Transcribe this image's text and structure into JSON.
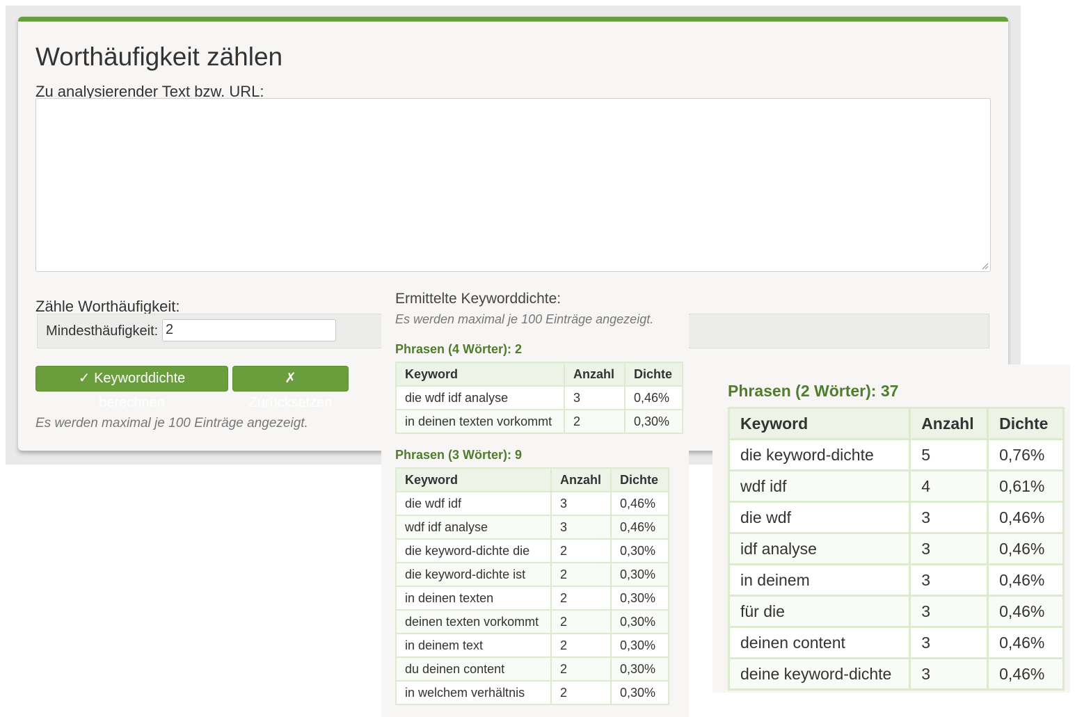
{
  "form": {
    "title": "Worthäufigkeit zählen",
    "text_label": "Zu analysierender Text bzw. URL:",
    "text_value": "",
    "count_label": "Zähle Worthäufigkeit:",
    "min_label": "Mindesthäufigkeit:",
    "min_value": "2",
    "calc_button": "✓ Keyworddichte berechnen",
    "reset_button": "✗ Zurücksetzen",
    "note": "Es werden maximal je 100 Einträge angezeigt."
  },
  "results": {
    "heading": "Ermittelte Keyworddichte:",
    "note": "Es werden maximal je 100 Einträge angezeigt.",
    "columns": [
      "Keyword",
      "Anzahl",
      "Dichte"
    ],
    "phrases4": {
      "title": "Phrasen (4 Wörter): 2",
      "rows": [
        [
          "die wdf idf analyse",
          "3",
          "0,46%"
        ],
        [
          "in deinen texten vorkommt",
          "2",
          "0,30%"
        ]
      ]
    },
    "phrases3": {
      "title": "Phrasen (3 Wörter): 9",
      "rows": [
        [
          "die wdf idf",
          "3",
          "0,46%"
        ],
        [
          "wdf idf analyse",
          "3",
          "0,46%"
        ],
        [
          "die keyword-dichte die",
          "2",
          "0,30%"
        ],
        [
          "die keyword-dichte ist",
          "2",
          "0,30%"
        ],
        [
          "in deinen texten",
          "2",
          "0,30%"
        ],
        [
          "deinen texten vorkommt",
          "2",
          "0,30%"
        ],
        [
          "in deinem text",
          "2",
          "0,30%"
        ],
        [
          "du deinen content",
          "2",
          "0,30%"
        ],
        [
          "in welchem verhältnis",
          "2",
          "0,30%"
        ]
      ]
    },
    "phrases2": {
      "title": "Phrasen (2 Wörter): 37",
      "rows": [
        [
          "die keyword-dichte",
          "5",
          "0,76%"
        ],
        [
          "wdf idf",
          "4",
          "0,61%"
        ],
        [
          "die wdf",
          "3",
          "0,46%"
        ],
        [
          "idf analyse",
          "3",
          "0,46%"
        ],
        [
          "in deinem",
          "3",
          "0,46%"
        ],
        [
          "für die",
          "3",
          "0,46%"
        ],
        [
          "deinen content",
          "3",
          "0,46%"
        ],
        [
          "deine keyword-dichte",
          "3",
          "0,46%"
        ]
      ]
    }
  },
  "colors": {
    "accent": "#6a9e3c",
    "section_title": "#4f7d2b",
    "table_border": "#dcebcd",
    "panel_bg": "#f7f6f4"
  }
}
